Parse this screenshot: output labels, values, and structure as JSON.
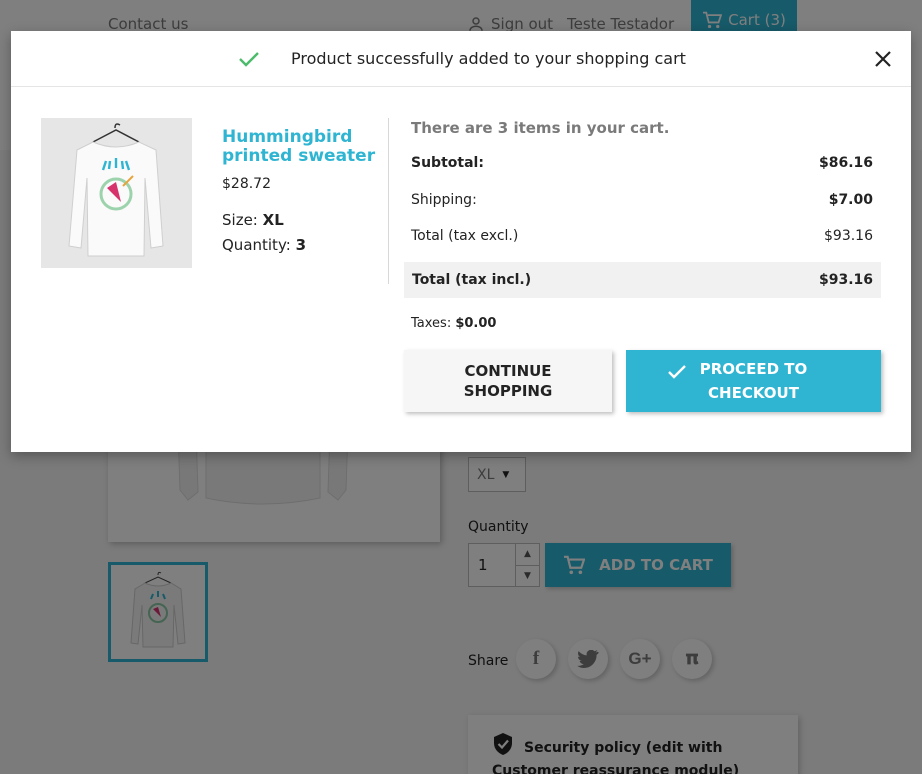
{
  "background": {
    "nav": {
      "contact": "Contact us",
      "signout": "Sign out",
      "user": "Teste Testador",
      "cart": "Cart (3)"
    },
    "size_select": "XL",
    "quantity_label": "Quantity",
    "quantity_value": "1",
    "add_to_cart": "ADD TO CART",
    "share_label": "Share",
    "share_icons": [
      "facebook-icon",
      "twitter-icon",
      "google-plus-icon",
      "pinterest-icon"
    ],
    "security_policy": "Security policy (edit with Customer reassurance module)"
  },
  "modal": {
    "title": "Product successfully added to your shopping cart",
    "product": {
      "name": "Hummingbird printed sweater",
      "price": "$28.72",
      "size_label": "Size:",
      "size_value": "XL",
      "quantity_label": "Quantity:",
      "quantity_value": "3"
    },
    "cart": {
      "count_text": "There are 3 items in your cart.",
      "subtotal_label": "Subtotal:",
      "subtotal_value": "$86.16",
      "shipping_label": "Shipping:",
      "shipping_value": "$7.00",
      "total_excl_label": "Total (tax excl.)",
      "total_excl_value": "$93.16",
      "total_incl_label": "Total (tax incl.)",
      "total_incl_value": "$93.16",
      "taxes_label": "Taxes:",
      "taxes_value": "$0.00"
    },
    "buttons": {
      "continue_line1": "CONTINUE",
      "continue_line2": "SHOPPING",
      "checkout_line1": "PROCEED TO",
      "checkout_line2": "CHECKOUT"
    }
  },
  "colors": {
    "accent": "#2fb5d2",
    "success": "#4cbb6c"
  }
}
